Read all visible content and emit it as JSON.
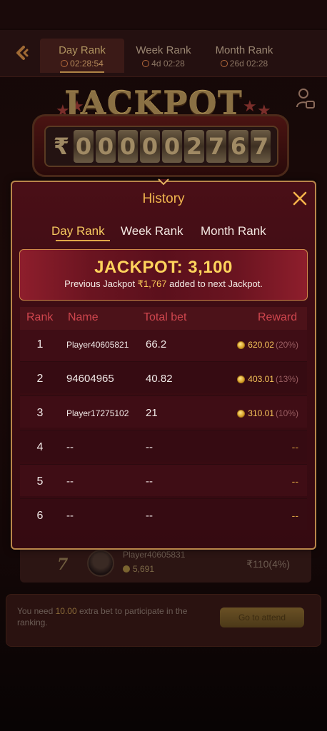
{
  "header": {
    "tabs": [
      {
        "label": "Day Rank",
        "time": "02:28:54"
      },
      {
        "label": "Week Rank",
        "time": "4d 02:28"
      },
      {
        "label": "Month Rank",
        "time": "26d 02:28"
      }
    ]
  },
  "jackpot_display": {
    "title": "JACKPOT",
    "currency": "₹",
    "digits": [
      "0",
      "0",
      "0",
      "0",
      "0",
      "2",
      "7",
      "6",
      "7"
    ]
  },
  "background_row": {
    "rank": "7",
    "player": "Player40605831",
    "coins": "5,691",
    "reward": "₹110(4%)"
  },
  "notice": {
    "text_before": "You need ",
    "amount": "10.00",
    "text_after": " extra bet to participate in the ranking.",
    "button_label": "Go to attend"
  },
  "modal": {
    "title": "History",
    "tabs": [
      {
        "label": "Day Rank"
      },
      {
        "label": "Week Rank"
      },
      {
        "label": "Month Rank"
      }
    ],
    "banner": {
      "title": "JACKPOT: 3,100",
      "sub_before": "Previous Jackpot ",
      "sub_amount": "₹1,767",
      "sub_after": " added to next Jackpot."
    },
    "columns": {
      "rank": "Rank",
      "name": "Name",
      "bet": "Total bet",
      "reward": "Reward"
    },
    "rows": [
      {
        "rank": "1",
        "name": "Player40605821",
        "bet": "66.2",
        "reward": "620.02",
        "pct": "(20%)"
      },
      {
        "rank": "2",
        "name": "94604965",
        "bet": "40.82",
        "reward": "403.01",
        "pct": "(13%)"
      },
      {
        "rank": "3",
        "name": "Player17275102",
        "bet": "21",
        "reward": "310.01",
        "pct": "(10%)"
      },
      {
        "rank": "4",
        "name": "--",
        "bet": "--",
        "reward": "--"
      },
      {
        "rank": "5",
        "name": "--",
        "bet": "--",
        "reward": "--"
      },
      {
        "rank": "6",
        "name": "--",
        "bet": "--",
        "reward": "--"
      }
    ]
  },
  "colors": {
    "accent_gold": "#f6c45a",
    "modal_bg": "#3c0c13",
    "header_red": "#d0464e"
  }
}
